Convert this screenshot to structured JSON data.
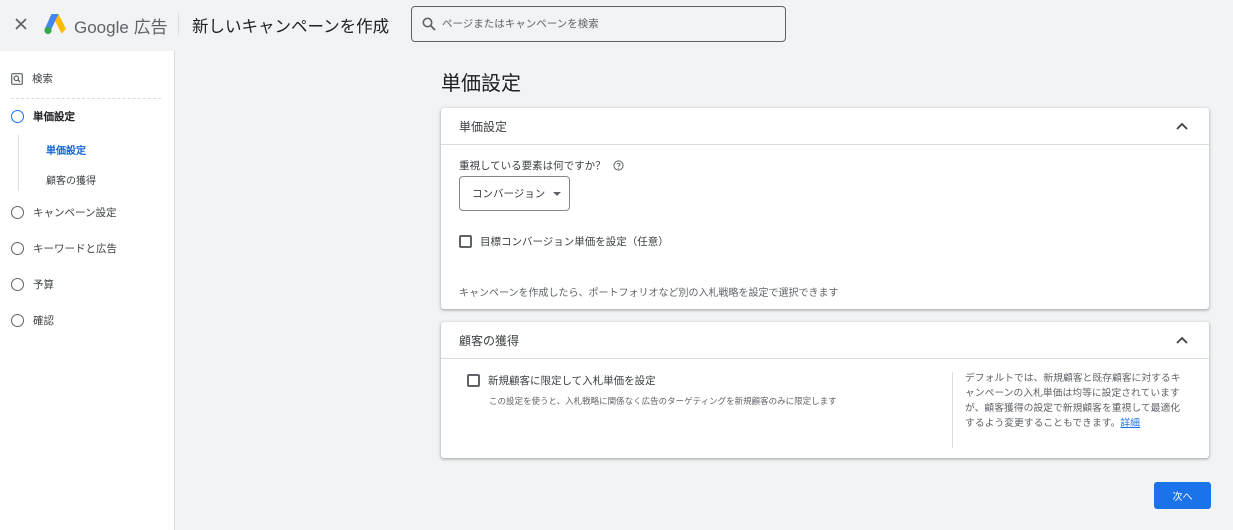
{
  "header": {
    "brand_google": "Google",
    "brand_ads": "広告",
    "title": "新しいキャンペーンを作成",
    "search_placeholder": "ページまたはキャンペーンを検索"
  },
  "sidebar": {
    "search_label": "検索",
    "steps": [
      {
        "label": "単価設定",
        "active": true
      },
      {
        "label": "キャンペーン設定"
      },
      {
        "label": "キーワードと広告"
      },
      {
        "label": "予算"
      },
      {
        "label": "確認"
      }
    ],
    "substeps": [
      {
        "label": "単価設定",
        "active": true
      },
      {
        "label": "顧客の獲得"
      }
    ]
  },
  "main": {
    "title": "単価設定",
    "bidding_card": {
      "title": "単価設定",
      "question": "重視している要素は何ですか？",
      "dropdown_value": "コンバージョン",
      "checkbox_label": "目標コンバージョン単価を設定（任意）",
      "note": "キャンペーンを作成したら、ポートフォリオなど別の入札戦略を設定で選択できます"
    },
    "acquisition_card": {
      "title": "顧客の獲得",
      "checkbox_label": "新規顧客に限定して入札単価を設定",
      "description": "この設定を使うと、入札戦略に関係なく広告のターゲティングを新規顧客のみに限定します",
      "side_note": "デフォルトでは、新規顧客と既存顧客に対するキャンペーンの入札単価は均等に設定されていますが、顧客獲得の設定で新規顧客を重視して最適化するよう変更することもできます。",
      "side_link": "詳細"
    },
    "next_button": "次へ"
  },
  "colors": {
    "accent": "#1a73e8",
    "background": "#f1f3f4"
  }
}
